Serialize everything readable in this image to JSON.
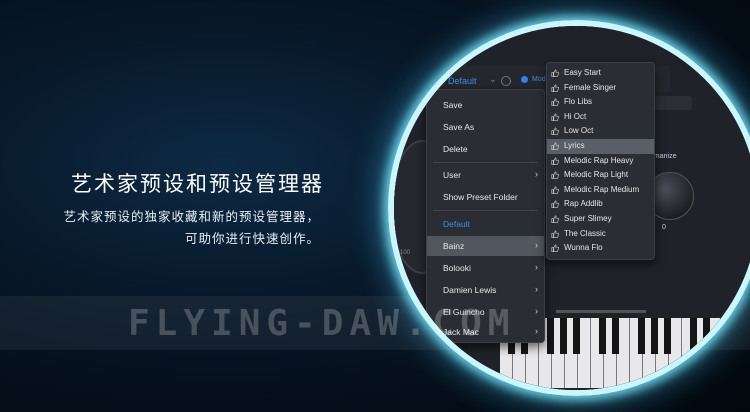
{
  "promo": {
    "headline": "艺术家预设和预设管理器",
    "description_line1": "艺术家预设的独家收藏和新的预设管理器，",
    "description_line2": "可助你进行快速创作。"
  },
  "watermark": "FLYING-DAW.COM",
  "plugin": {
    "preset_name": "Default",
    "mode_label": "Mod",
    "humanize_label": "umanize",
    "knob_value": "0",
    "dial_tick": "-100"
  },
  "preset_menu": {
    "items": [
      {
        "label": "Save",
        "has_submenu": false
      },
      {
        "label": "Save As",
        "has_submenu": false
      },
      {
        "label": "Delete",
        "has_submenu": false
      },
      {
        "label": "User",
        "has_submenu": true
      },
      {
        "label": "Show Preset Folder",
        "has_submenu": false
      },
      {
        "label": "Default",
        "has_submenu": false
      },
      {
        "label": "Bainz",
        "has_submenu": true
      },
      {
        "label": "Bolooki",
        "has_submenu": true
      },
      {
        "label": "Damien Lewis",
        "has_submenu": true
      },
      {
        "label": "El Guincho",
        "has_submenu": true
      },
      {
        "label": "Jack Mac",
        "has_submenu": true
      }
    ],
    "selected": "Bainz",
    "highlighted": "Default",
    "arrow_glyph": "›"
  },
  "bainz_submenu": {
    "items": [
      "Easy Start",
      "Female Singer",
      "Flo Libs",
      "Hi Oct",
      "Low Oct",
      "Lyrics",
      "Melodic Rap Heavy",
      "Melodic Rap Light",
      "Melodic Rap Medium",
      "Rap Addlib",
      "Super Slimey",
      "The Classic",
      "Wunna Flo"
    ],
    "selected": "Lyrics",
    "item_icon": "thumbs-up-icon"
  },
  "colors": {
    "accent": "#3d8ce6",
    "ring": "#c9f6ff"
  }
}
